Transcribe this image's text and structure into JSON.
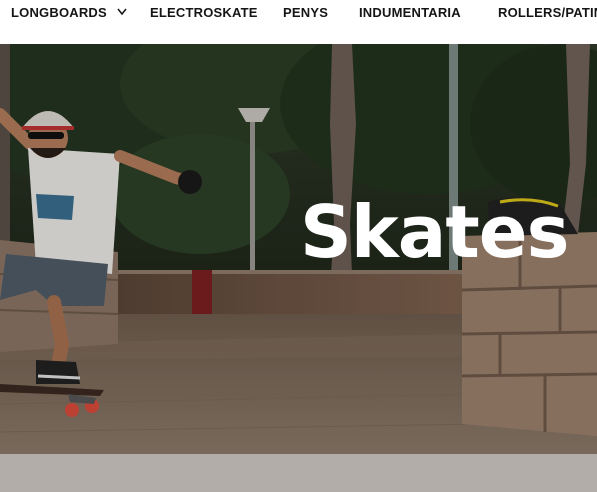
{
  "nav": {
    "items": [
      {
        "label": "LONGBOARDS",
        "has_dropdown": true
      },
      {
        "label": "ELECTROSKATE"
      },
      {
        "label": "PENYS"
      },
      {
        "label": "INDUMENTARIA"
      },
      {
        "label": "ROLLERS/PATIN"
      }
    ],
    "dropdown_icon": "chevron-down-icon"
  },
  "hero": {
    "title": "Skates"
  },
  "colors": {
    "nav_background": "#ffffff",
    "nav_text": "#151515",
    "hero_title": "#ffffff",
    "bottom_band": "#b3ada9"
  }
}
